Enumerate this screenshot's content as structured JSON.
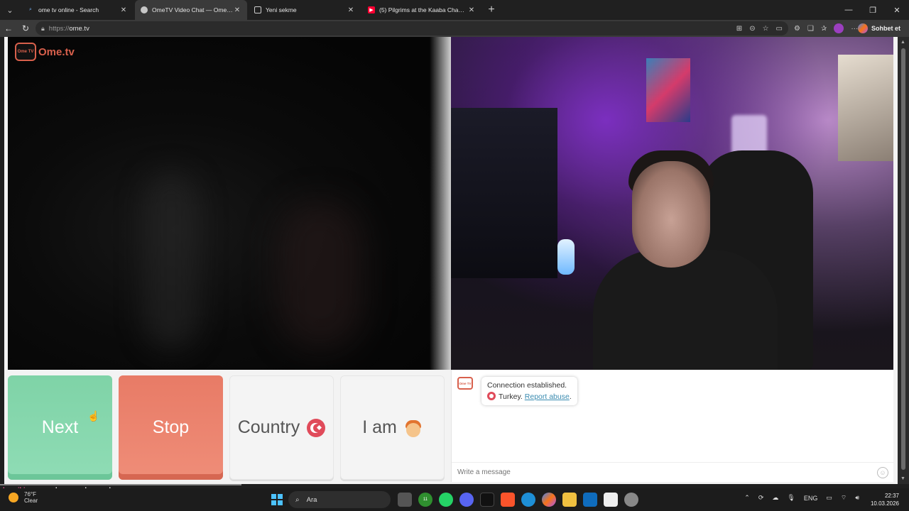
{
  "browser": {
    "tabs": [
      {
        "title": "ome tv online - Search",
        "active": false
      },
      {
        "title": "OmeTV Video Chat — Omegle Alternative",
        "active": true
      },
      {
        "title": "Yeni sekme",
        "active": false
      },
      {
        "title": "(5) Pilgrims at the Kaaba Chant \"Here I Am\"",
        "active": false
      }
    ],
    "url_protocol": "https://",
    "url_host": "ome.tv",
    "copilot_label": "Sohbet et"
  },
  "page": {
    "brand_logo_text": "Ome TV",
    "brand_name": "Ome.tv",
    "buttons": {
      "next": "Next",
      "stop": "Stop",
      "country": "Country",
      "iam": "I am"
    },
    "chat": {
      "logo_text": "Ome TV",
      "status": "Connection established.",
      "country": "Turkey.",
      "report_link": "Report abuse",
      "report_suffix": ".",
      "input_placeholder": "Write a message"
    }
  },
  "overlay": {
    "username": "buzgibieyran",
    "message": ": oe hesap makınasından gırıyor"
  },
  "taskbar": {
    "weather_temp": "76°F",
    "weather_desc": "Clear",
    "search_placeholder": "Ara",
    "language": "ENG",
    "time": "22:37",
    "date": "10.03.2026",
    "badge_count": "11"
  },
  "colors": {
    "next_button": "#8fdcb5",
    "stop_button": "#ef8d78",
    "brand": "#d8604c",
    "link": "#3a8bb0"
  }
}
